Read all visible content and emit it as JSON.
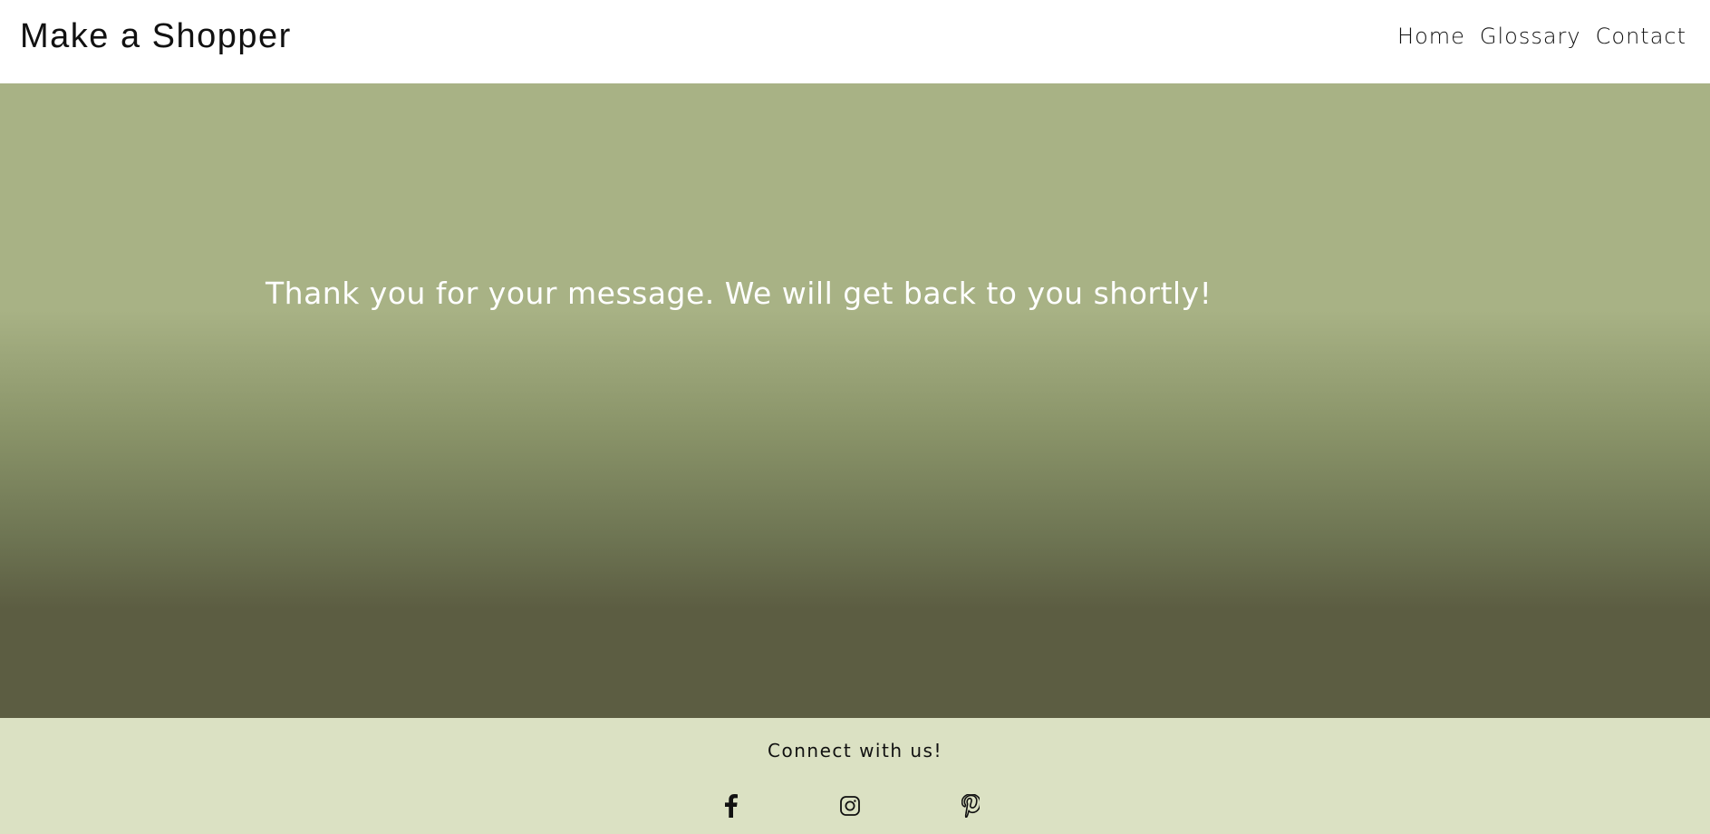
{
  "header": {
    "site_title": "Make a Shopper",
    "nav": [
      {
        "label": "Home"
      },
      {
        "label": "Glossary"
      },
      {
        "label": "Contact"
      }
    ]
  },
  "hero": {
    "message": "Thank you for your message. We will get back to you shortly!",
    "gradient_top_color": "#a8b285",
    "gradient_bottom_color": "#5c5d42"
  },
  "footer": {
    "connect_text": "Connect with us!",
    "background_color": "#dbe1c3",
    "social_icons": [
      "facebook-icon",
      "instagram-icon",
      "pinterest-icon"
    ]
  }
}
